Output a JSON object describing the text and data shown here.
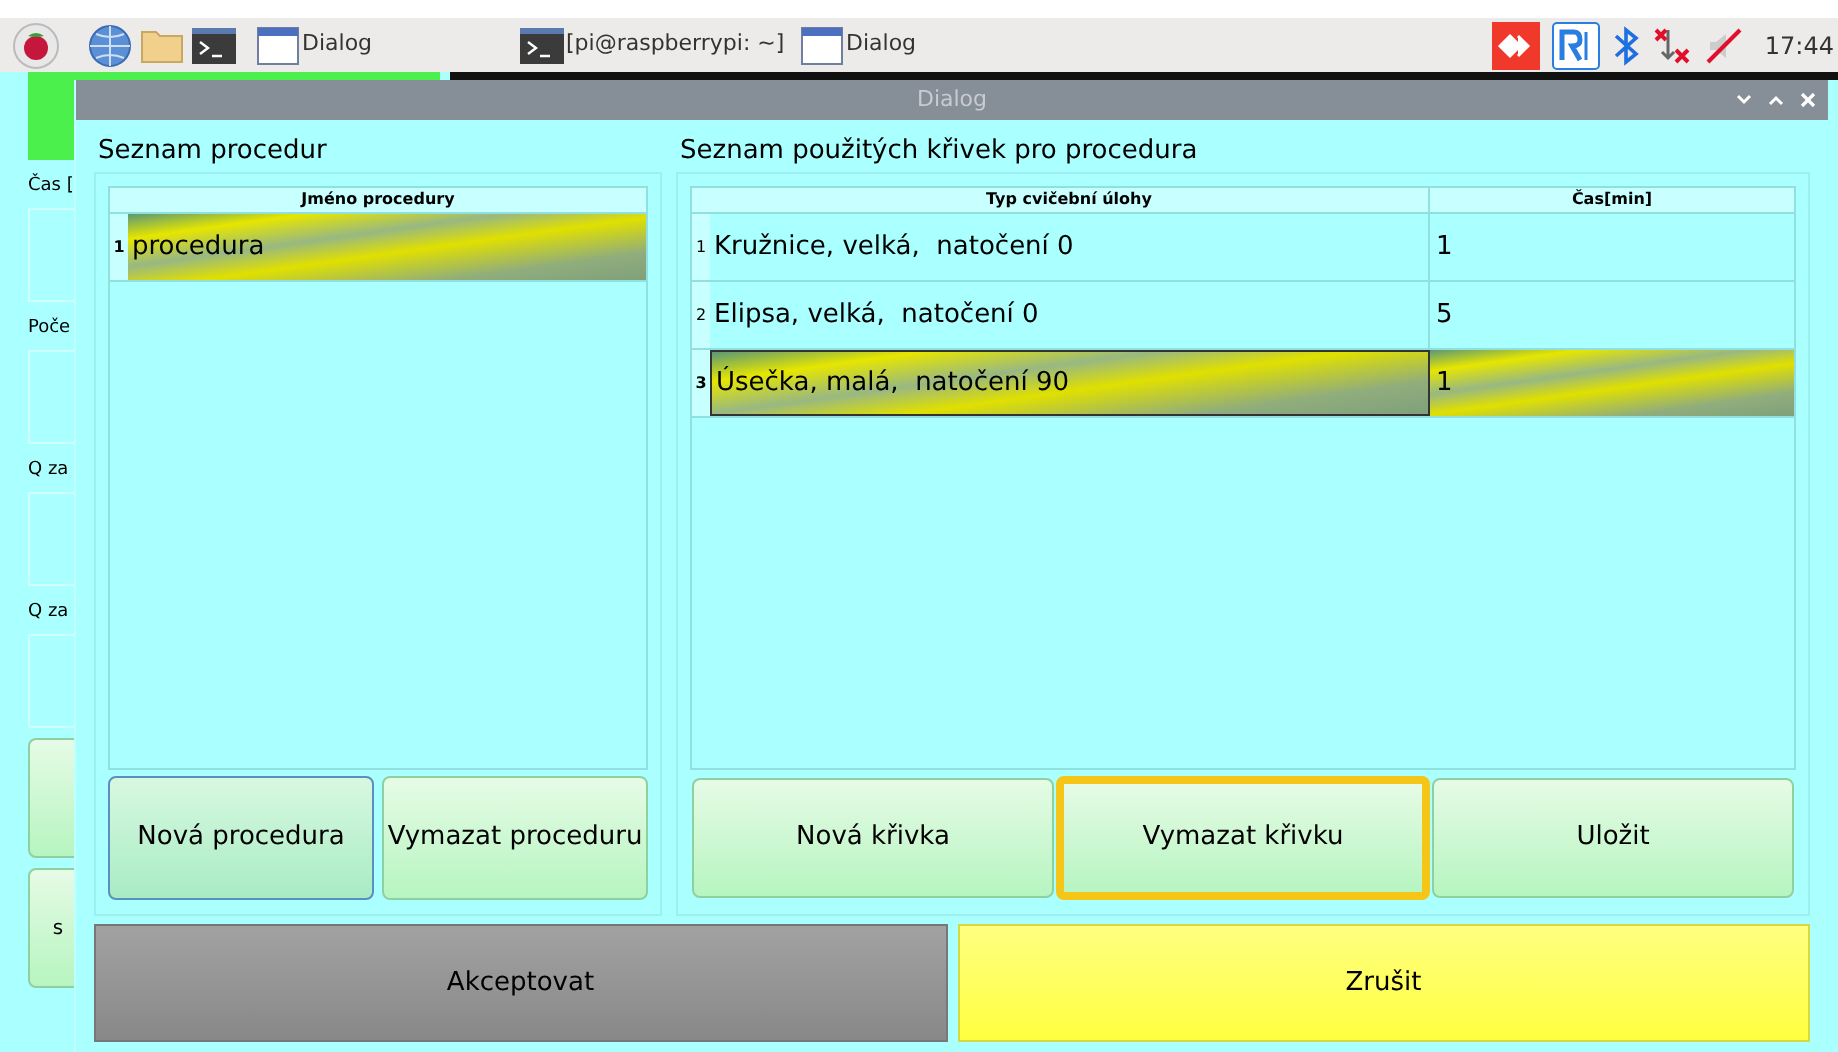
{
  "taskbar": {
    "windows": [
      {
        "title": "Dialog",
        "kind": "window"
      },
      {
        "title": "[pi@raspberrypi: ~]",
        "kind": "terminal"
      },
      {
        "title": "Dialog",
        "kind": "window"
      }
    ],
    "clock": "17:44"
  },
  "background_window": {
    "labels": [
      "Čas [",
      "Poče",
      "Q za",
      "Q za"
    ],
    "button_label": "s"
  },
  "dialog": {
    "title": "Dialog",
    "procedures": {
      "heading": "Seznam procedur",
      "column": "Jméno procedury",
      "rows": [
        {
          "number": "1",
          "name": "procedura",
          "selected": true
        }
      ],
      "buttons": [
        {
          "label": "Nová procedura",
          "focused": true
        },
        {
          "label": "Vymazat proceduru",
          "focused": false
        }
      ]
    },
    "curves": {
      "heading": "Seznam použitých křivek pro procedura",
      "columns": [
        "Typ cvičební úlohy",
        "Čas[min]"
      ],
      "rows": [
        {
          "number": "1",
          "type": "Kružnice, velká,  natočení 0",
          "time": "1",
          "selected": false
        },
        {
          "number": "2",
          "type": "Elipsa, velká,  natočení 0",
          "time": "5",
          "selected": false
        },
        {
          "number": "3",
          "type": "Úsečka, malá,  natočení 90",
          "time": "1",
          "selected": true
        }
      ],
      "buttons": [
        {
          "label": "Nová křivka",
          "highlighted": false
        },
        {
          "label": "Vymazat křivku",
          "highlighted": true
        },
        {
          "label": "Uložit",
          "highlighted": false
        }
      ]
    },
    "footer": [
      {
        "label": "Akceptovat",
        "kind": "accept"
      },
      {
        "label": "Zrušit",
        "kind": "cancel"
      }
    ]
  }
}
